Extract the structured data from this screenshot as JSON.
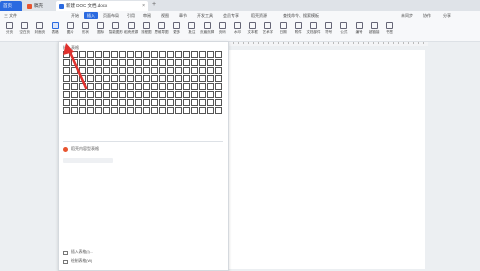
{
  "tabs": {
    "home": "首页",
    "draft": "稿壳",
    "doc": "新建 DOC 文档.docx"
  },
  "menu": {
    "file": "三 文件",
    "items": [
      "开始",
      "插入",
      "页面布局",
      "引用",
      "审阅",
      "视图",
      "章节",
      "开发工具",
      "会员专享",
      "稻壳资源"
    ],
    "search": "查找命令、搜索模板",
    "right": [
      "未同步",
      "协作",
      "分享"
    ]
  },
  "toolbar": {
    "tools": [
      "分页",
      "空白页",
      "封面页",
      "表格",
      "图片",
      "形状",
      "图标",
      "智能图形",
      "稻壳资源",
      "流程图",
      "思维导图",
      "更多",
      "批注",
      "页眉页脚",
      "页码",
      "水印",
      "文本框",
      "艺术字",
      "日期",
      "附件",
      "文档部件",
      "符号",
      "公式",
      "编号",
      "超链接",
      "书签"
    ]
  },
  "dropdown": {
    "label": "插入表格",
    "rows": 8,
    "cols": 20,
    "recommend": "稻壳内容型表格",
    "bottom": [
      "插入表格(I)...",
      "绘制表格(W)"
    ]
  },
  "colors": {
    "accent": "#2b6ae0",
    "annotation": "#e0312d"
  }
}
